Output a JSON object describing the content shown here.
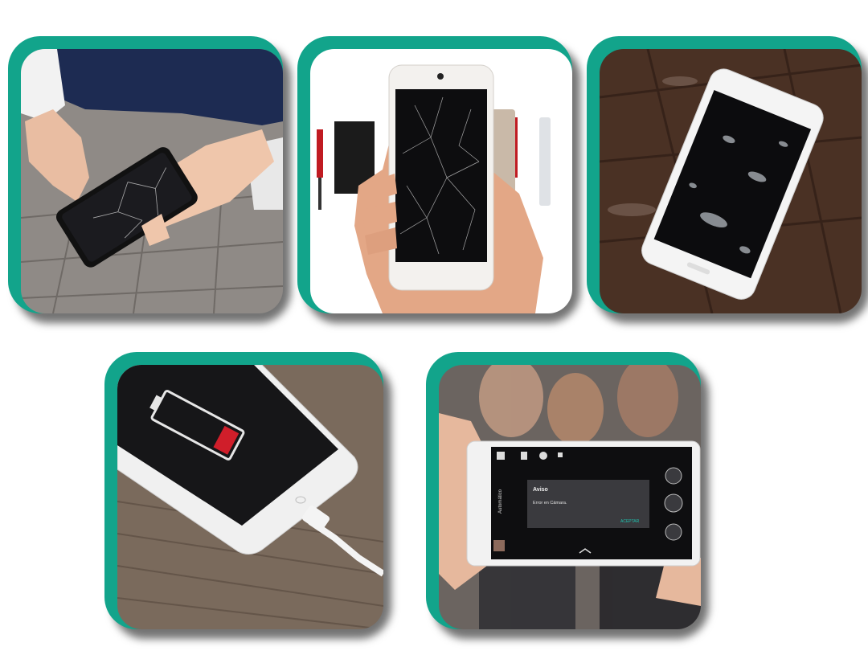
{
  "tiles": [
    {
      "scene": "dropped phone with cracked screen on pavement"
    },
    {
      "scene": "hand holding phone with shattered screen next to repair tools"
    },
    {
      "scene": "white phone with water droplets on wet wooden table"
    },
    {
      "scene": "phone showing low battery while charging on wooden surface"
    },
    {
      "scene": "phone camera app showing error dialog in front of a group of people"
    }
  ],
  "camera_dialog": {
    "title": "Aviso",
    "message": "Error en Cámara.",
    "button": "ACEPTAR",
    "mode_label": "Automático"
  },
  "colors": {
    "frame": "#12a48b",
    "battery_low": "#d01e2a"
  }
}
